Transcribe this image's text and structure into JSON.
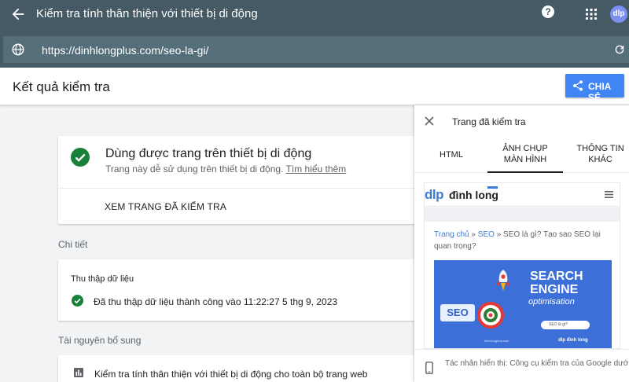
{
  "app": {
    "title": "Kiểm tra tính thân thiện với thiết bị di động",
    "avatar_text": "dlp"
  },
  "urlbar": {
    "url": "https://dinhlongplus.com/seo-la-gi/"
  },
  "result": {
    "title": "Kết quả kiểm tra",
    "share_label": "CHIA SẺ"
  },
  "summary": {
    "heading": "Dùng được trang trên thiết bị di động",
    "subtext": "Trang này dễ sử dụng trên thiết bị di động.",
    "learn_more": "Tìm hiểu thêm",
    "view_page": "XEM TRANG ĐÃ KIỂM TRA"
  },
  "details": {
    "section_label": "Chi tiết",
    "card_title": "Thu thập dữ liệu",
    "status_text": "Đã thu thập dữ liệu thành công vào 11:22:27 5 thg 9, 2023"
  },
  "resources": {
    "section_label": "Tài nguyên bổ sung",
    "link_text": "Kiểm tra tính thân thiện với thiết bị di động cho toàn bộ trang web"
  },
  "panel": {
    "title": "Trang đã kiểm tra",
    "tabs": [
      {
        "line1": "HTML",
        "line2": ""
      },
      {
        "line1": "ẢNH CHỤP",
        "line2": "MÀN HÌNH"
      },
      {
        "line1": "THÔNG TIN",
        "line2": "KHÁC"
      }
    ],
    "active_tab": 1,
    "screenshot": {
      "logo_mark": "dlp",
      "logo_name": "đình long",
      "crumb_home": "Trang chủ",
      "crumb_sep1": " » ",
      "crumb_seo": "SEO",
      "crumb_rest": " » SEO là gì? Tạo sao SEO lại quan trọng?",
      "hero_title_1": "SEARCH",
      "hero_title_2": "ENGINE",
      "hero_sub": "optimisation",
      "hero_search": "SEO là gì?",
      "hero_seo": "SEO",
      "hero_site": "dinhlongplus.com",
      "hero_logo": "dlp đình long"
    },
    "footer": "Tác nhân hiển thị: Công cụ kiểm tra của Google dưới dạng điện thoại thông minh"
  },
  "colors": {
    "appbar": "#455a64",
    "url_box": "#546e7a",
    "accent_blue": "#4285f4",
    "success_green": "#188038"
  },
  "icons": {
    "back": "arrow-left-icon",
    "help": "help-circle-icon",
    "apps": "apps-grid-icon",
    "globe": "globe-icon",
    "reload": "refresh-icon",
    "share": "share-icon",
    "check": "check-circle-icon",
    "close": "close-icon",
    "report": "bar-chart-icon",
    "phone": "smartphone-icon"
  }
}
